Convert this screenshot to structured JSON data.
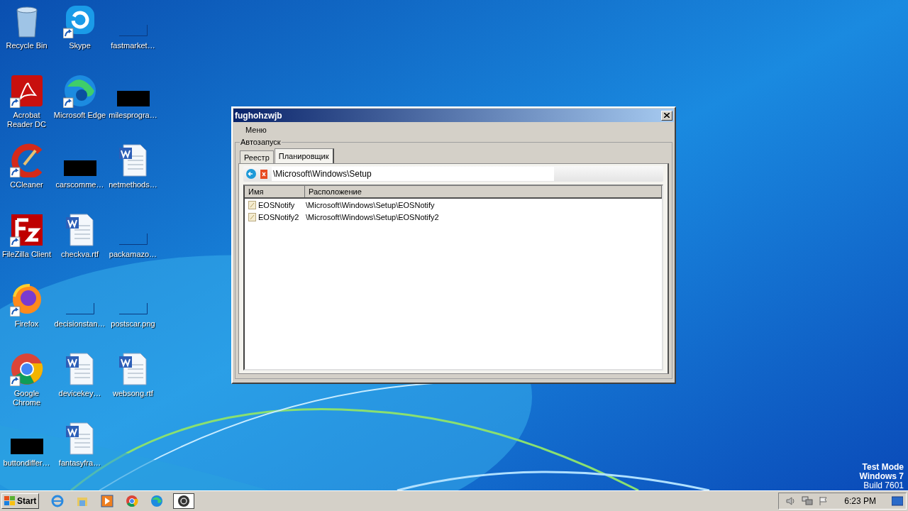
{
  "desktop": {
    "icons": [
      {
        "label": "Recycle Bin",
        "kind": "recycle",
        "shortcut": false
      },
      {
        "label": "Skype",
        "kind": "skype",
        "shortcut": true
      },
      {
        "label": "fastmarket…",
        "kind": "blank",
        "shortcut": false
      },
      {
        "label": "Acrobat Reader DC",
        "kind": "pdf",
        "shortcut": true
      },
      {
        "label": "Microsoft Edge",
        "kind": "edge",
        "shortcut": true
      },
      {
        "label": "milesprogra…",
        "kind": "black",
        "shortcut": false
      },
      {
        "label": "CCleaner",
        "kind": "ccleaner",
        "shortcut": true
      },
      {
        "label": "carscomme…",
        "kind": "black",
        "shortcut": false
      },
      {
        "label": "netmethods…",
        "kind": "word",
        "shortcut": false
      },
      {
        "label": "FileZilla Client",
        "kind": "filezilla",
        "shortcut": true
      },
      {
        "label": "checkva.rtf",
        "kind": "word",
        "shortcut": false
      },
      {
        "label": "packamazo…",
        "kind": "blank",
        "shortcut": false
      },
      {
        "label": "Firefox",
        "kind": "firefox",
        "shortcut": true
      },
      {
        "label": "decisionstan…",
        "kind": "blank",
        "shortcut": false
      },
      {
        "label": "postscar.png",
        "kind": "blank",
        "shortcut": false
      },
      {
        "label": "Google Chrome",
        "kind": "chrome",
        "shortcut": true
      },
      {
        "label": "devicekey…",
        "kind": "word",
        "shortcut": false
      },
      {
        "label": "websong.rtf",
        "kind": "word",
        "shortcut": false
      },
      {
        "label": "buttondiffer…",
        "kind": "black",
        "shortcut": false
      },
      {
        "label": "fantasyfra…",
        "kind": "word",
        "shortcut": false
      }
    ],
    "os_notice": [
      "Test Mode",
      "Windows 7",
      "Build 7601"
    ]
  },
  "window": {
    "title": "fughohzwjb",
    "menu": [
      "Меню"
    ],
    "group_label": "Автозапуск",
    "tabs": [
      {
        "label": "Реестр",
        "selected": false
      },
      {
        "label": "Планировщик",
        "selected": true
      }
    ],
    "path": "\\Microsoft\\Windows\\Setup",
    "columns": [
      "Имя",
      "Расположение"
    ],
    "rows": [
      {
        "name": "EOSNotify",
        "location": "\\Microsoft\\Windows\\Setup\\EOSNotify"
      },
      {
        "name": "EOSNotify2",
        "location": "\\Microsoft\\Windows\\Setup\\EOSNotify2"
      }
    ]
  },
  "taskbar": {
    "start": "Start",
    "apps": [
      {
        "kind": "ie",
        "active": false
      },
      {
        "kind": "explorer",
        "active": false
      },
      {
        "kind": "media",
        "active": false
      },
      {
        "kind": "chrome",
        "active": false
      },
      {
        "kind": "edge",
        "active": false
      },
      {
        "kind": "app",
        "active": true
      }
    ],
    "clock": "6:23 PM"
  }
}
